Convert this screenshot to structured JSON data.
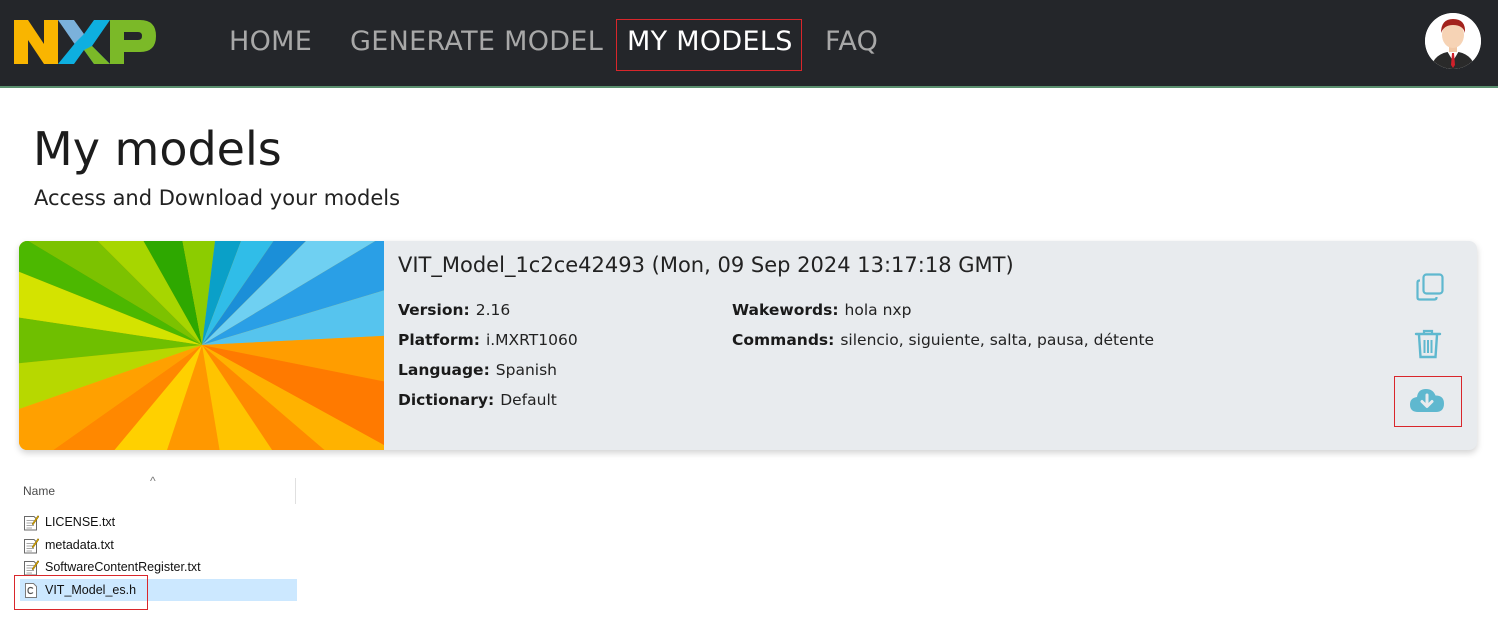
{
  "nav": {
    "logo_text": "NXP",
    "items": [
      {
        "label": "HOME",
        "active": false
      },
      {
        "label": "GENERATE MODEL",
        "active": false
      },
      {
        "label": "MY MODELS",
        "active": true
      },
      {
        "label": "FAQ",
        "active": false
      }
    ],
    "accent_color": "#d9262b"
  },
  "page": {
    "title": "My models",
    "subtitle": "Access and Download your models"
  },
  "model_card": {
    "title": "VIT_Model_1c2ce42493 (Mon, 09 Sep 2024 13:17:18 GMT)",
    "fields": {
      "version": {
        "label": "Version:",
        "value": "2.16"
      },
      "platform": {
        "label": "Platform:",
        "value": "i.MXRT1060"
      },
      "language": {
        "label": "Language:",
        "value": "Spanish"
      },
      "dictionary": {
        "label": "Dictionary:",
        "value": "Default"
      },
      "wakewords": {
        "label": "Wakewords:",
        "value": "hola nxp"
      },
      "commands": {
        "label": "Commands:",
        "value": "silencio, siguiente, salta, pausa, détente"
      }
    },
    "actions": [
      {
        "icon": "copy-icon"
      },
      {
        "icon": "trash-icon"
      },
      {
        "icon": "cloud-download-icon"
      }
    ],
    "action_color": "#5fb8cf"
  },
  "file_explorer": {
    "column_header": "Name",
    "files": [
      {
        "name": "LICENSE.txt",
        "icon": "text-file-icon",
        "selected": false
      },
      {
        "name": "metadata.txt",
        "icon": "text-file-icon",
        "selected": false
      },
      {
        "name": "SoftwareContentRegister.txt",
        "icon": "text-file-icon",
        "selected": false
      },
      {
        "name": "VIT_Model_es.h",
        "icon": "c-header-file-icon",
        "selected": true
      }
    ]
  }
}
